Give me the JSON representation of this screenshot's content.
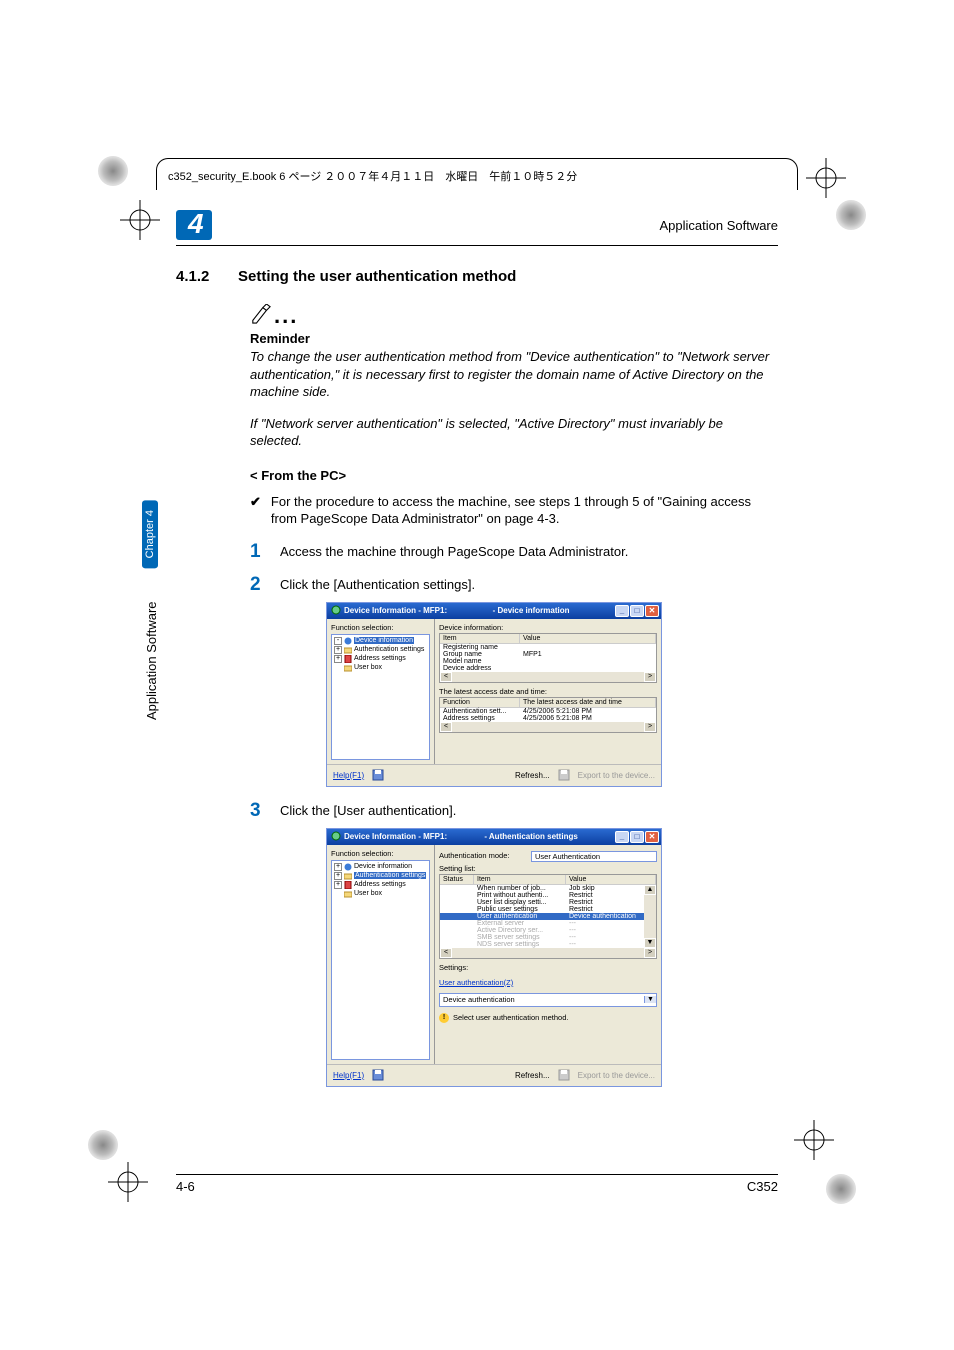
{
  "page_header": "c352_security_E.book  6 ページ  ２００７年４月１１日　水曜日　午前１０時５２分",
  "chapter_badge": "4",
  "app_sw_label": "Application Software",
  "section": {
    "number": "4.1.2",
    "title": "Setting the user authentication method"
  },
  "reminder": {
    "label": "Reminder",
    "para1": "To change the user authentication method from \"Device authentication\" to \"Network server authentication,\" it is necessary first to register the domain name of Active Directory on the machine side.",
    "para2": "If \"Network server authentication\" is selected, \"Active Directory\" must invariably be selected."
  },
  "from_pc": "< From the PC>",
  "check_line": "For the procedure to access the machine, see steps 1 through 5 of \"Gaining access from PageScope Data Administrator\" on page 4-3.",
  "steps": {
    "s1": "Access the machine through PageScope Data Administrator.",
    "s2": "Click the [Authentication settings].",
    "s3": "Click the [User authentication]."
  },
  "shot1": {
    "title_left": "Device Information - MFP1:",
    "title_center": "- Device information",
    "left_title": "Function selection:",
    "tree": {
      "n1": "Device information",
      "n2": "Authentication settings",
      "n3": "Address settings",
      "n4": "User box"
    },
    "right": {
      "group1": "Device information:",
      "hdr_item": "Item",
      "hdr_value": "Value",
      "rows": {
        "r1": "Registering name",
        "r2": "Group name",
        "r2v": "MFP1",
        "r3": "Model name",
        "r4": "Device address"
      },
      "group2": "The latest access date and time:",
      "hdr_func": "Function",
      "hdr_date": "The latest access date and time",
      "d1l": "Authentication sett...",
      "d1v": "4/25/2006 5:21:08 PM",
      "d2l": "Address settings",
      "d2v": "4/25/2006 5:21:08 PM"
    },
    "bottom": {
      "help": "Help(F1)",
      "refresh": "Refresh...",
      "export": "Export to the device..."
    }
  },
  "shot2": {
    "title_left": "Device Information - MFP1:",
    "title_center": "- Authentication settings",
    "left_title": "Function selection:",
    "tree": {
      "n1": "Device information",
      "n2": "Authentication settings",
      "n3": "Address settings",
      "n4": "User box"
    },
    "auth_mode_label": "Authentication mode:",
    "auth_mode_value": "User Authentication",
    "setting_list": "Setting list:",
    "hdr_status": "Status",
    "hdr_item": "Item",
    "hdr_value": "Value",
    "rows": {
      "r1i": "When number of job...",
      "r1v": "Job skip",
      "r2i": "Print without authenti...",
      "r2v": "Restrict",
      "r3i": "User list display setti...",
      "r3v": "Restrict",
      "r4i": "Public user settings",
      "r4v": "Restrict",
      "r5i": "User authentication",
      "r5v": "Device authentication",
      "r6i": "External server",
      "r6v": "---",
      "r7i": "Active Directory ser...",
      "r7v": "---",
      "r8i": "SMB server settings",
      "r8v": "---",
      "r9i": "NDS server settings",
      "r9v": "---"
    },
    "settings_label": "Settings:",
    "ua_link": "User authentication(Z)",
    "combo": "Device authentication",
    "hint": "Select user authentication method.",
    "bottom": {
      "help": "Help(F1)",
      "refresh": "Refresh...",
      "export": "Export to the device..."
    }
  },
  "side": {
    "chapter": "Chapter 4",
    "label": "Application Software"
  },
  "footer": {
    "page": "4-6",
    "model": "C352"
  }
}
